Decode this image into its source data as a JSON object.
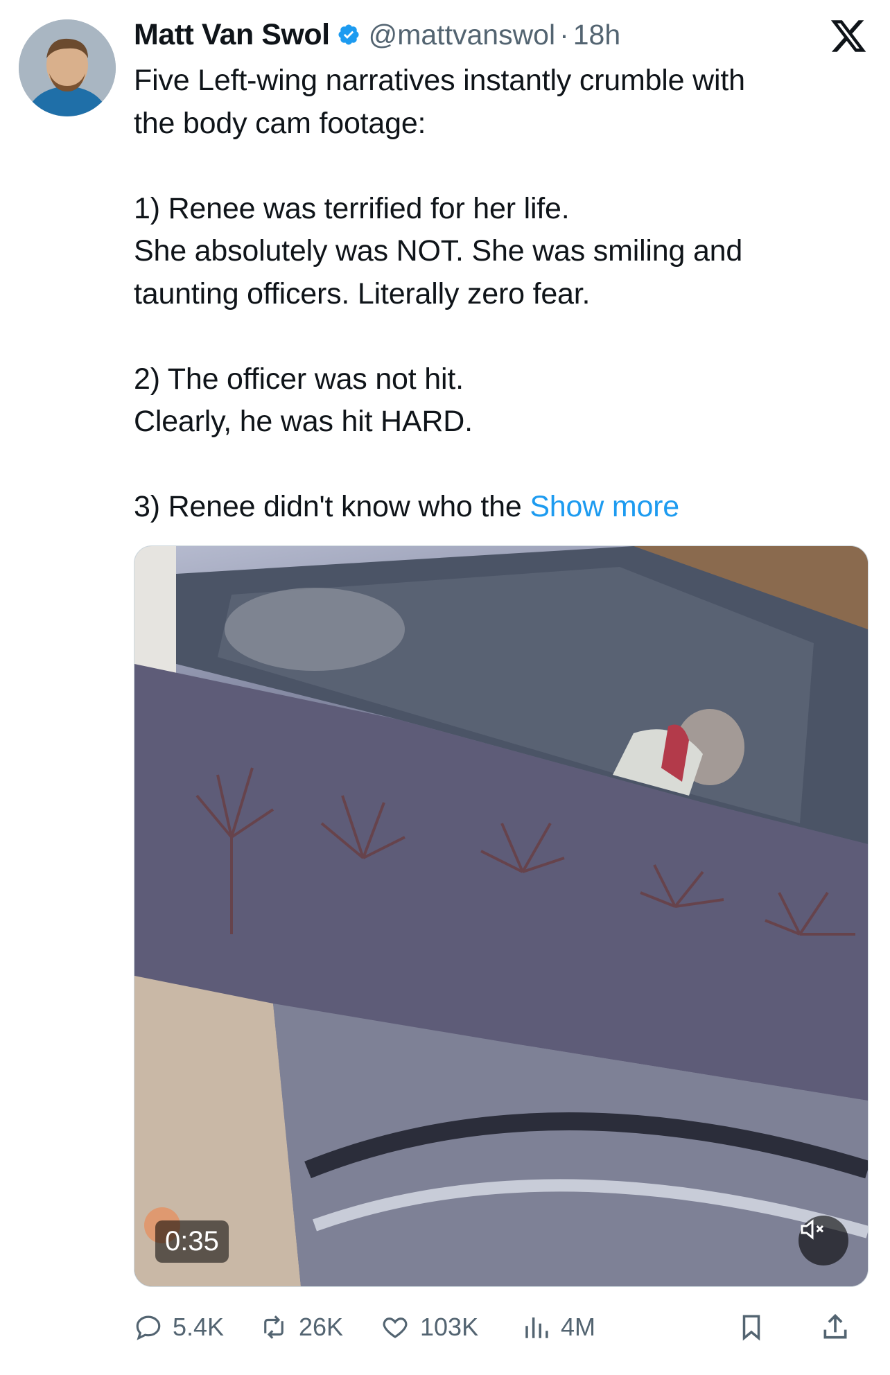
{
  "author": {
    "name": "Matt Van Swol",
    "handle": "@mattvanswol",
    "separator": "·",
    "time": "18h",
    "verified": true
  },
  "tweet": {
    "lines": [
      "Five Left-wing narratives instantly crumble with",
      "the body cam footage:",
      "",
      "1) Renee was terrified for her life.",
      "She absolutely was NOT. She was smiling and",
      "taunting officers. Literally zero fear.",
      "",
      "2) The officer was not hit.",
      "Clearly, he was hit HARD.",
      "",
      "3) Renee didn't know who the "
    ],
    "show_more": "Show more"
  },
  "media": {
    "duration": "0:35",
    "muted": true
  },
  "actions": {
    "replies": "5.4K",
    "reposts": "26K",
    "likes": "103K",
    "views": "4M"
  },
  "colors": {
    "text": "#0f1419",
    "secondary": "#536471",
    "link": "#1d9bf0",
    "verified": "#1d9bf0"
  },
  "icons": [
    "x-logo-icon",
    "verified-badge-icon",
    "reply-icon",
    "repost-icon",
    "like-icon",
    "views-icon",
    "bookmark-icon",
    "share-icon",
    "mute-icon"
  ]
}
